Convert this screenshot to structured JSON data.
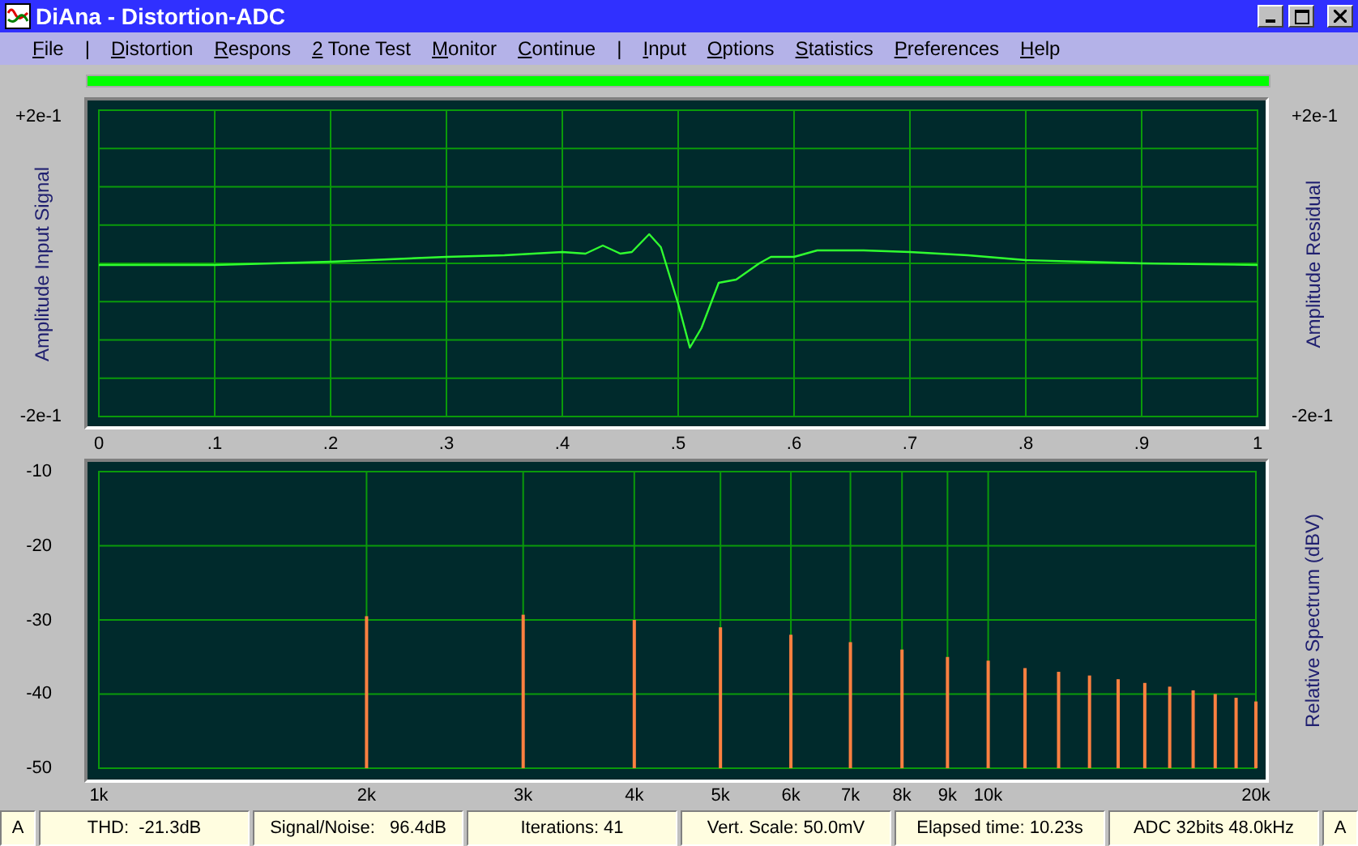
{
  "window": {
    "title": "DiAna - Distortion-ADC"
  },
  "menu": [
    {
      "kind": "item",
      "label": "File"
    },
    {
      "kind": "separator",
      "label": "|"
    },
    {
      "kind": "item",
      "label": "Distortion"
    },
    {
      "kind": "item",
      "label": "Respons"
    },
    {
      "kind": "item",
      "label": "2 Tone Test"
    },
    {
      "kind": "item",
      "label": "Monitor"
    },
    {
      "kind": "item",
      "label": "Continue"
    },
    {
      "kind": "separator",
      "label": "|"
    },
    {
      "kind": "item",
      "label": "Input"
    },
    {
      "kind": "item",
      "label": "Options"
    },
    {
      "kind": "item",
      "label": "Statistics"
    },
    {
      "kind": "item",
      "label": "Preferences"
    },
    {
      "kind": "item",
      "label": "Help"
    }
  ],
  "progress": {
    "level": 1
  },
  "waveform": {
    "ylabel_left": "Amplitude Input Signal",
    "ylabel_right": "Amplitude Residual",
    "left_top": "+2e-1",
    "left_bottom": "-2e-1",
    "right_top": "+2e-1",
    "right_bottom": "-2e-1",
    "xticks": [
      "0",
      ".1",
      ".2",
      ".3",
      ".4",
      ".5",
      ".6",
      ".7",
      ".8",
      ".9",
      "1"
    ]
  },
  "spectrum": {
    "ylabel": "Relative Spectrum (dBV)",
    "xticks": [
      "1k",
      "2k",
      "3k",
      "4k",
      "5k",
      "6k",
      "7k",
      "8k",
      "9k",
      "10k",
      "20k"
    ],
    "yticks": [
      "-10",
      "-20",
      "-30",
      "-40",
      "-50"
    ]
  },
  "status_bar": [
    "A",
    "THD:  -21.3dB",
    "Signal/Noise:   96.4dB",
    "Iterations: 41",
    "Vert. Scale: 50.0mV",
    "Elapsed time: 10.23s",
    "ADC 32bits 48.0kHz",
    "A"
  ]
}
